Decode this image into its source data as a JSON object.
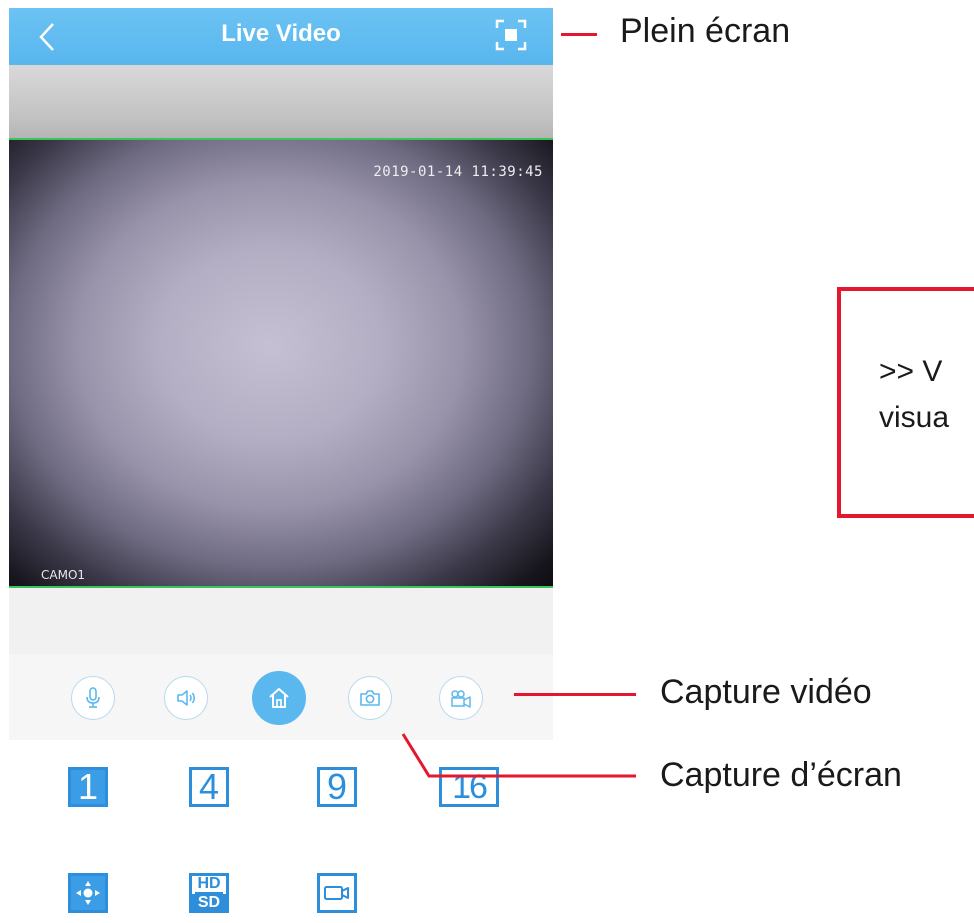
{
  "app": {
    "title": "Live Video",
    "back_icon": "chevron-left-icon",
    "fullscreen_icon": "fullscreen-icon",
    "colors": {
      "navbar": "#5ab7ef",
      "accent": "#2d8fdc",
      "video_border": "#3cc35a"
    }
  },
  "video": {
    "timestamp": "2019-01-14 11:39:45",
    "camera_label": "CAMO1"
  },
  "toolbar": {
    "buttons": [
      {
        "icon": "microphone-icon"
      },
      {
        "icon": "speaker-icon"
      },
      {
        "icon": "home-icon",
        "selected": true
      },
      {
        "icon": "camera-icon"
      },
      {
        "icon": "video-record-icon"
      }
    ]
  },
  "layout_buttons": {
    "items": [
      {
        "label": "1",
        "selected": true
      },
      {
        "label": "4"
      },
      {
        "label": "9"
      },
      {
        "label": "16"
      }
    ]
  },
  "bottom_buttons": {
    "hd_top": "HD",
    "hd_bottom": "SD",
    "icons": [
      "ptz-direction-icon",
      "hd-sd-toggle-icon",
      "video-playback-icon"
    ]
  },
  "annotations": {
    "fullscreen": "Plein écran",
    "video_capture": "Capture vidéo",
    "screen_capture": "Capture d’écran",
    "note_line1": ">>  V",
    "note_line2": "visua",
    "color": "#e4172f"
  }
}
